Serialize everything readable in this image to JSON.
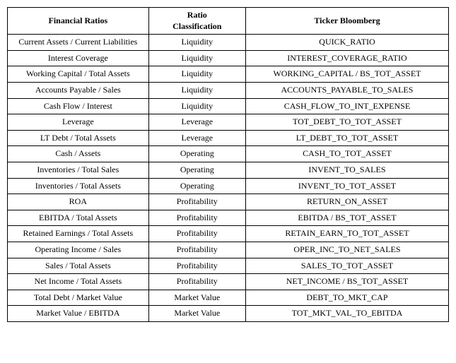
{
  "table": {
    "headers": [
      "Financial Ratios",
      "Ratio Classification",
      "Ticker Bloomberg"
    ],
    "rows": [
      {
        "ratio": "Current Assets / Current Liabilities",
        "classification": "Liquidity",
        "ticker": "QUICK_RATIO"
      },
      {
        "ratio": "Interest Coverage",
        "classification": "Liquidity",
        "ticker": "INTEREST_COVERAGE_RATIO"
      },
      {
        "ratio": "Working Capital / Total Assets",
        "classification": "Liquidity",
        "ticker": "WORKING_CAPITAL / BS_TOT_ASSET"
      },
      {
        "ratio": "Accounts Payable / Sales",
        "classification": "Liquidity",
        "ticker": "ACCOUNTS_PAYABLE_TO_SALES"
      },
      {
        "ratio": "Cash Flow / Interest",
        "classification": "Liquidity",
        "ticker": "CASH_FLOW_TO_INT_EXPENSE"
      },
      {
        "ratio": "Leverage",
        "classification": "Leverage",
        "ticker": "TOT_DEBT_TO_TOT_ASSET"
      },
      {
        "ratio": "LT Debt / Total Assets",
        "classification": "Leverage",
        "ticker": "LT_DEBT_TO_TOT_ASSET"
      },
      {
        "ratio": "Cash / Assets",
        "classification": "Operating",
        "ticker": "CASH_TO_TOT_ASSET"
      },
      {
        "ratio": "Inventories / Total Sales",
        "classification": "Operating",
        "ticker": "INVENT_TO_SALES"
      },
      {
        "ratio": "Inventories / Total Assets",
        "classification": "Operating",
        "ticker": "INVENT_TO_TOT_ASSET"
      },
      {
        "ratio": "ROA",
        "classification": "Profitability",
        "ticker": "RETURN_ON_ASSET"
      },
      {
        "ratio": "EBITDA / Total Assets",
        "classification": "Profitability",
        "ticker": "EBITDA /  BS_TOT_ASSET"
      },
      {
        "ratio": "Retained Earnings / Total Assets",
        "classification": "Profitability",
        "ticker": "RETAIN_EARN_TO_TOT_ASSET"
      },
      {
        "ratio": "Operating Income / Sales",
        "classification": "Profitability",
        "ticker": "OPER_INC_TO_NET_SALES"
      },
      {
        "ratio": "Sales / Total Assets",
        "classification": "Profitability",
        "ticker": "SALES_TO_TOT_ASSET"
      },
      {
        "ratio": "Net Income / Total Assets",
        "classification": "Profitability",
        "ticker": "NET_INCOME /  BS_TOT_ASSET"
      },
      {
        "ratio": "Total Debt / Market Value",
        "classification": "Market Value",
        "ticker": "DEBT_TO_MKT_CAP"
      },
      {
        "ratio": "Market Value / EBITDA",
        "classification": "Market Value",
        "ticker": "TOT_MKT_VAL_TO_EBITDA"
      }
    ]
  }
}
